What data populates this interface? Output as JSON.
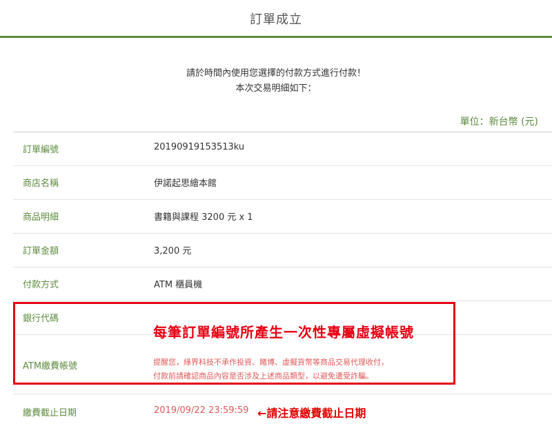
{
  "header": {
    "title": "訂單成立"
  },
  "intro": {
    "line1": "請於時間內使用您選擇的付款方式進行付款！",
    "line2": "本次交易明細如下："
  },
  "unit_label": "單位：新台幣 (元)",
  "rows": [
    {
      "label": "訂單編號",
      "value": "20190919153513ku"
    },
    {
      "label": "商店名稱",
      "value": "伊諾起思繪本館"
    },
    {
      "label": "商品明細",
      "value": "書籍與課程 3200 元 x 1"
    },
    {
      "label": "訂單金額",
      "value": "3,200 元"
    },
    {
      "label": "付款方式",
      "value": "ATM 櫃員機"
    },
    {
      "label": "銀行代碼",
      "value": ""
    },
    {
      "label": "ATM繳費帳號",
      "value": ""
    },
    {
      "label": "繳費截止日期",
      "value": "2019/09/22 23:59:59"
    }
  ],
  "annotation": {
    "big": "每筆訂單編號所產生一次性專屬虛擬帳號",
    "warning_line1": "提醒您，綠界科技不承作投資、賭博、虛擬貨幣等商品交易代理收付，",
    "warning_line2": "付款前請確認商品內容是否涉及上述商品類型，以避免遭受詐騙。",
    "deadline_note": "←請注意繳費截止日期"
  },
  "colors": {
    "accent_green": "#5c8a3c",
    "alert_red": "#e50012",
    "soft_red": "#e05a5a"
  }
}
